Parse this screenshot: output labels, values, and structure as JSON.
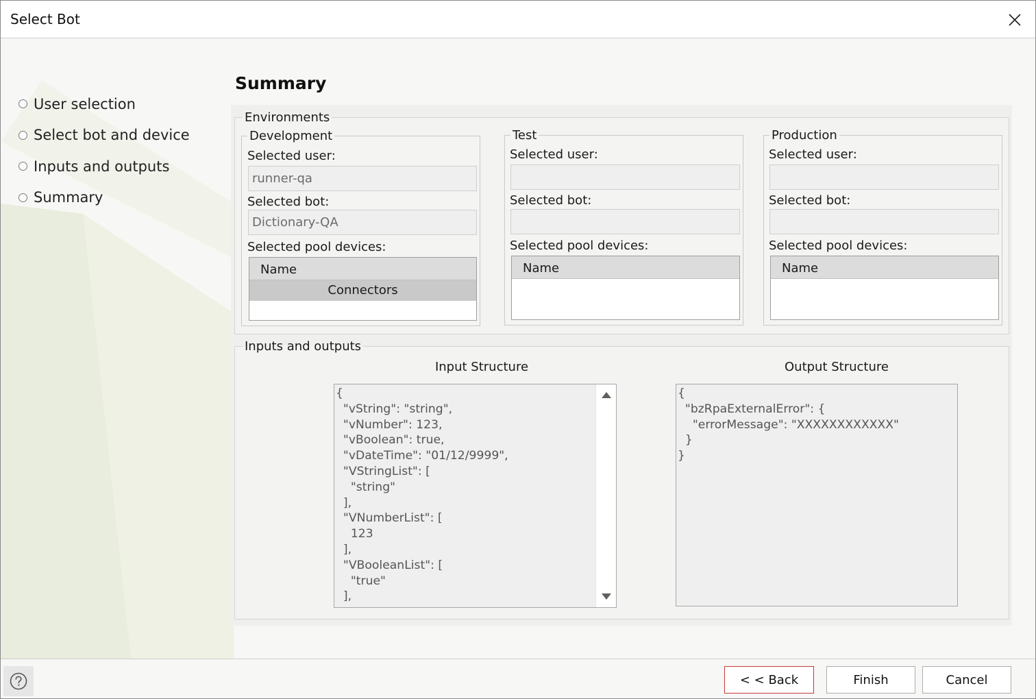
{
  "window": {
    "title": "Select Bot"
  },
  "steps": [
    {
      "label": "User selection"
    },
    {
      "label": "Select bot and device"
    },
    {
      "label": "Inputs and outputs"
    },
    {
      "label": "Summary"
    }
  ],
  "summary": {
    "title": "Summary",
    "environments_label": "Environments",
    "environments": [
      {
        "name": "Development",
        "user_label": "Selected user:",
        "user_value": "runner-qa",
        "bot_label": "Selected bot:",
        "bot_value": "Dictionary-QA",
        "devices_label": "Selected pool devices:",
        "grid_header": "Name",
        "grid_group": "Connectors"
      },
      {
        "name": "Test",
        "user_label": "Selected user:",
        "user_value": "",
        "bot_label": "Selected bot:",
        "bot_value": "",
        "devices_label": "Selected pool devices:",
        "grid_header": "Name"
      },
      {
        "name": "Production",
        "user_label": "Selected user:",
        "user_value": "",
        "bot_label": "Selected bot:",
        "bot_value": "",
        "devices_label": "Selected pool devices:",
        "grid_header": "Name"
      }
    ],
    "io": {
      "label": "Inputs and outputs",
      "input_title": "Input Structure",
      "input_text": "{\n  \"vString\": \"string\",\n  \"vNumber\": 123,\n  \"vBoolean\": true,\n  \"vDateTime\": \"01/12/9999\",\n  \"VStringList\": [\n    \"string\"\n  ],\n  \"VNumberList\": [\n    123\n  ],\n  \"VBooleanList\": [\n    \"true\"\n  ],",
      "output_title": "Output Structure",
      "output_text": "{\n  \"bzRpaExternalError\": {\n    \"errorMessage\": \"XXXXXXXXXXXX\"\n  }\n}"
    }
  },
  "footer": {
    "back_label": "< < Back",
    "finish_label": "Finish",
    "cancel_label": "Cancel"
  },
  "colors": {
    "panel_bg": "#efefed",
    "grid_header_bg": "#dcdcdc",
    "back_focus_border": "#c23b3b"
  },
  "icons": {
    "close": "close-icon",
    "help": "help-icon",
    "scroll_up": "scroll-up-arrow-icon",
    "scroll_down": "scroll-down-arrow-icon",
    "step_bullet": "step-bullet-icon"
  }
}
